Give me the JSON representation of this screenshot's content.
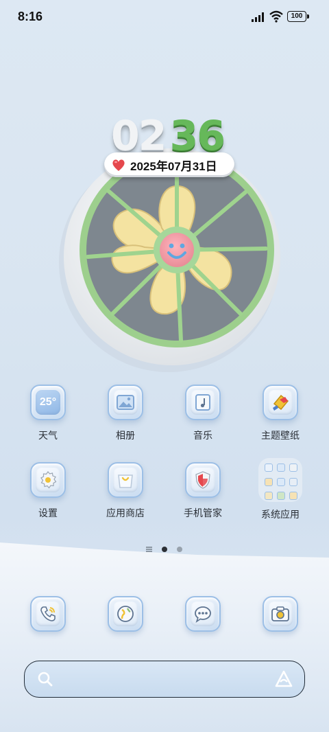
{
  "status_bar": {
    "time": "8:16",
    "battery": "100"
  },
  "widget": {
    "hours": "02",
    "minutes": "36",
    "date": "2025年07月31日"
  },
  "apps_row1": [
    {
      "label": "天气",
      "icon": "weather-icon",
      "tile_text": "25°"
    },
    {
      "label": "相册",
      "icon": "gallery-icon"
    },
    {
      "label": "音乐",
      "icon": "music-icon"
    },
    {
      "label": "主题壁纸",
      "icon": "themes-icon"
    }
  ],
  "apps_row2": [
    {
      "label": "设置",
      "icon": "gear-icon"
    },
    {
      "label": "应用商店",
      "icon": "app-store-icon"
    },
    {
      "label": "手机管家",
      "icon": "shield-icon"
    },
    {
      "label": "系统应用",
      "icon": "folder-icon"
    }
  ],
  "dock": [
    {
      "icon": "phone-icon"
    },
    {
      "icon": "browser-icon"
    },
    {
      "icon": "messages-icon"
    },
    {
      "icon": "camera-icon"
    }
  ],
  "colors": {
    "accent_green": "#66b85a",
    "tile_border": "#9cbfe6",
    "fan_blade": "#f4e3a1",
    "heart": "#e5484d"
  }
}
